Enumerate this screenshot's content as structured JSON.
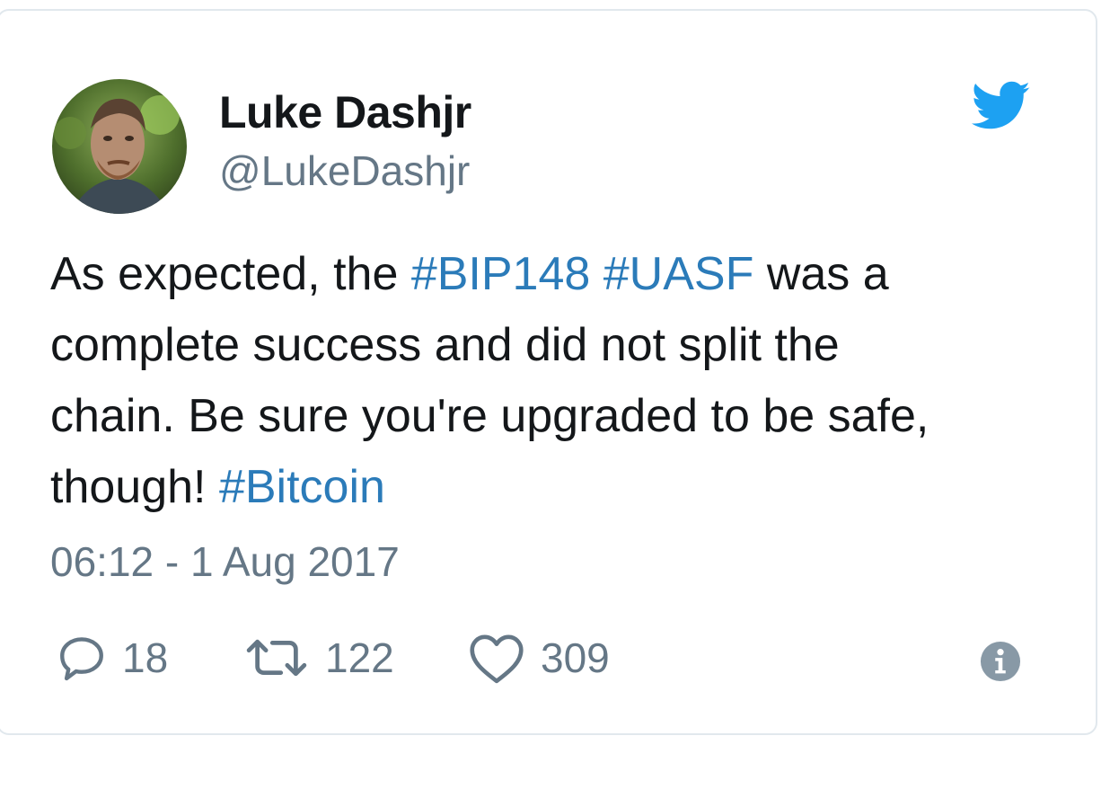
{
  "author": {
    "name": "Luke Dashjr",
    "handle": "@LukeDashjr"
  },
  "tweet": {
    "lines": [
      [
        {
          "text": "As expected, the ",
          "type": "text"
        },
        {
          "text": "#BIP148",
          "type": "hashtag"
        },
        {
          "text": " ",
          "type": "text"
        },
        {
          "text": "#UASF",
          "type": "hashtag"
        },
        {
          "text": " was a",
          "type": "text"
        }
      ],
      [
        {
          "text": "complete success and did not split the",
          "type": "text"
        }
      ],
      [
        {
          "text": "chain. Be sure you're upgraded to be safe,",
          "type": "text"
        }
      ],
      [
        {
          "text": "though! ",
          "type": "text"
        },
        {
          "text": "#Bitcoin",
          "type": "hashtag"
        }
      ]
    ],
    "timestamp": "06:12 - 1 Aug 2017"
  },
  "actions": {
    "reply_count": "18",
    "retweet_count": "122",
    "like_count": "309"
  },
  "icons": {
    "brand": "twitter-bird-icon",
    "reply": "reply-icon",
    "retweet": "retweet-icon",
    "like": "heart-icon",
    "info": "info-icon"
  },
  "colors": {
    "text": "#14171a",
    "secondary": "#657786",
    "hashtag": "#2b7bb9",
    "twitter_blue": "#1da1f2",
    "border": "#e1e8ed"
  }
}
